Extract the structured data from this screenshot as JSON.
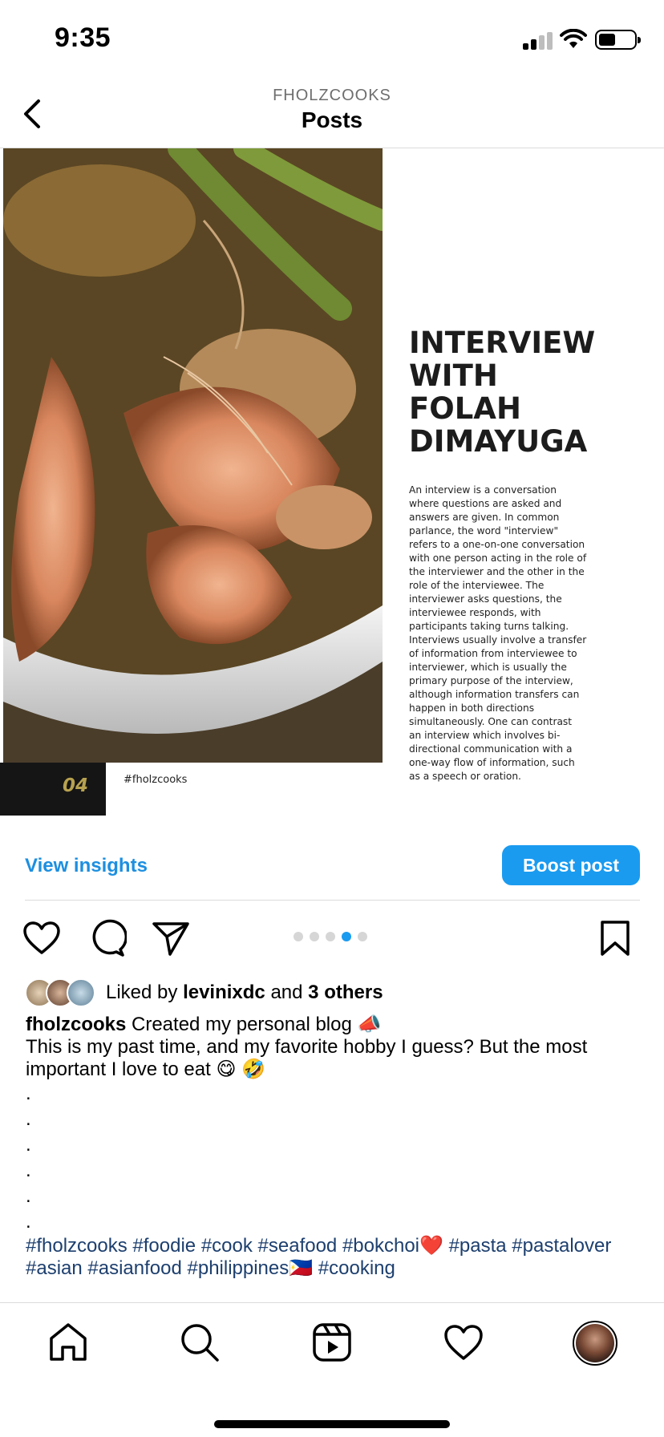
{
  "status_bar": {
    "time": "9:35"
  },
  "header": {
    "username": "FHOLZCOOKS",
    "title": "Posts"
  },
  "post_image": {
    "slide_number": "04",
    "hashtag": "#fholzcooks",
    "article_title_lines": [
      "INTERVIEW",
      "WITH",
      "FOLAH",
      "DIMAYUGA"
    ],
    "article_body": "An interview is a conversation where questions are asked and answers are given. In common parlance, the word \"interview\" refers to a one-on-one conversation with one person acting in the role of the interviewer and the other in the role of the interviewee. The interviewer asks questions, the interviewee responds, with participants taking turns talking. Interviews usually involve a transfer of information from interviewee to interviewer, which is usually the primary purpose of the interview, although information transfers can happen in both directions simultaneously. One can contrast an interview which involves bi-directional communication with a one-way flow of information, such as a speech or oration."
  },
  "insights": {
    "view_label": "View insights",
    "boost_label": "Boost post"
  },
  "carousel": {
    "total": 5,
    "active_index": 3
  },
  "likes": {
    "prefix": "Liked by ",
    "user": "levinixdc",
    "middle": " and ",
    "others": "3 others"
  },
  "caption": {
    "username": "fholzcooks",
    "first_line": " Created my personal blog 📣",
    "body": "This is my past time, and my favorite hobby I guess? But the most important I love to eat 😋 🤣",
    "dots": [
      ".",
      ".",
      ".",
      ".",
      ".",
      "."
    ],
    "hashtags": "#fholzcooks #foodie #cook #seafood #bokchoi❤️ #pasta #pastalover #asian #asianfood #philippines🇵🇭 #cooking"
  },
  "colors": {
    "accent": "#1a9bf0",
    "link": "#1d8fe0",
    "hashtag": "#1d3f6e",
    "slide_number": "#b8a24f"
  },
  "icons": {
    "back": "chevron-left-icon",
    "like": "heart-icon",
    "comment": "comment-icon",
    "share": "send-icon",
    "save": "bookmark-icon",
    "home": "home-icon",
    "search": "search-icon",
    "reels": "reels-icon",
    "activity": "heart-icon"
  }
}
